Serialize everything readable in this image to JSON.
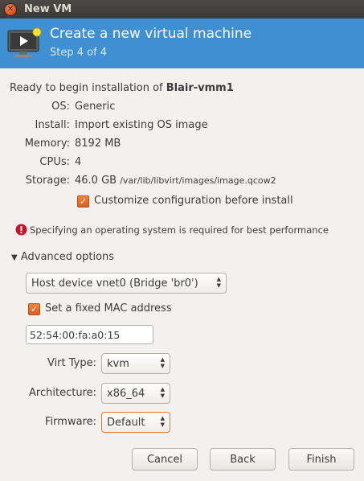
{
  "window": {
    "title": "New VM"
  },
  "header": {
    "title": "Create a new virtual machine",
    "step": "Step 4 of 4"
  },
  "summary": {
    "ready_prefix": "Ready to begin installation of ",
    "vm_name": "Blair-vmm1",
    "rows": [
      {
        "label": "OS:",
        "value": "Generic"
      },
      {
        "label": "Install:",
        "value": "Import existing OS image"
      },
      {
        "label": "Memory:",
        "value": "8192 MB"
      },
      {
        "label": "CPUs:",
        "value": "4"
      },
      {
        "label": "Storage:",
        "value_size": "46.0 GB",
        "value_path": "/var/lib/libvirt/images/image.qcow2"
      }
    ],
    "customize_label": "Customize configuration before install",
    "customize_checked": true
  },
  "warning": {
    "text": "Specifying an operating system is required for best performance"
  },
  "advanced": {
    "label": "Advanced options",
    "network": "Host device vnet0 (Bridge 'br0')",
    "mac_label": "Set a fixed MAC address",
    "mac_checked": true,
    "mac_value": "52:54:00:fa:a0:15",
    "virt_type_label": "Virt Type:",
    "virt_type": "kvm",
    "arch_label": "Architecture:",
    "arch": "x86_64",
    "firmware_label": "Firmware:",
    "firmware": "Default"
  },
  "buttons": {
    "cancel": "Cancel",
    "back": "Back",
    "finish": "Finish"
  },
  "colors": {
    "header": "#3f8fd3",
    "accent": "#dd5d1c",
    "warning": "#c7162b"
  }
}
